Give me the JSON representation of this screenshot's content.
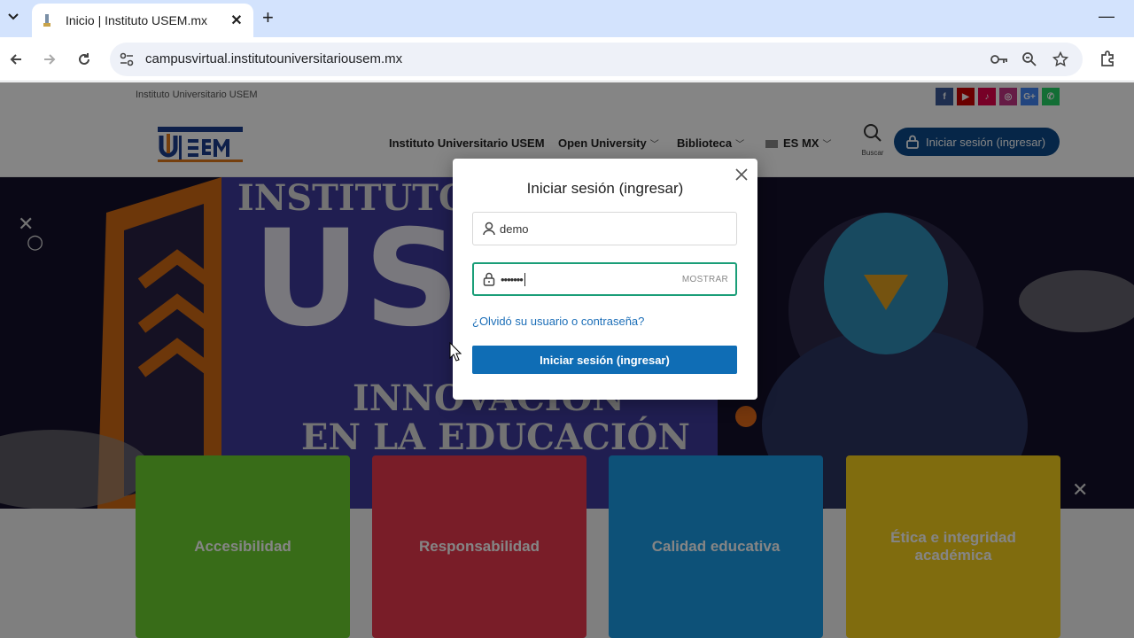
{
  "browser": {
    "tab_title": "Inicio | Instituto USEM.mx",
    "new_tab_symbol": "+",
    "url": "campusvirtual.institutouniversitariousem.mx",
    "icons": [
      "tab-list-icon",
      "close-icon",
      "new-tab-icon",
      "minimize-icon",
      "back-icon",
      "forward-icon",
      "reload-icon",
      "site-info-icon",
      "key-icon",
      "zoom-icon",
      "star-icon",
      "extensions-icon",
      "menu-icon"
    ]
  },
  "site": {
    "institution_name": "Instituto Universitario USEM",
    "social": [
      {
        "label": "f",
        "color": "#3b5998"
      },
      {
        "label": "▶",
        "color": "#cc0000"
      },
      {
        "label": "♪",
        "color": "#e4004b"
      },
      {
        "label": "◎",
        "color": "#c13584"
      },
      {
        "label": "G+",
        "color": "#4285f4"
      },
      {
        "label": "✆",
        "color": "#25d366"
      }
    ],
    "menu": {
      "item1": "Instituto Universitario USEM",
      "item2": "Open University",
      "item3": "Biblioteca",
      "language": "ES MX"
    },
    "search_caption": "Buscar",
    "login_button": "Iniciar sesión (ingresar)"
  },
  "hero": {
    "title_top": "INSTITUTO UN",
    "title_big": "USE",
    "line1": "INNOVACIÓN",
    "line2": "EN LA EDUCACIÓN"
  },
  "cards": [
    {
      "label": "Accesibilidad",
      "color": "#6ccf2e"
    },
    {
      "label": "Responsabilidad",
      "color": "#e8394e"
    },
    {
      "label": "Calidad educativa",
      "color": "#1a9be6"
    },
    {
      "label": "Ética e integridad académica",
      "color": "#f5cf1c"
    }
  ],
  "login_modal": {
    "title": "Iniciar sesión (ingresar)",
    "username_value": "demo",
    "password_value": "•••••••",
    "show_label": "MOSTRAR",
    "forgot_link": "¿Olvidó su usuario o contraseña?",
    "submit_label": "Iniciar sesión (ingresar)"
  },
  "colors": {
    "brand_dark_blue": "#0c4a8a",
    "submit_blue": "#0f6db5",
    "link_blue": "#1d6fb8",
    "focus_green": "#1a9e78"
  }
}
